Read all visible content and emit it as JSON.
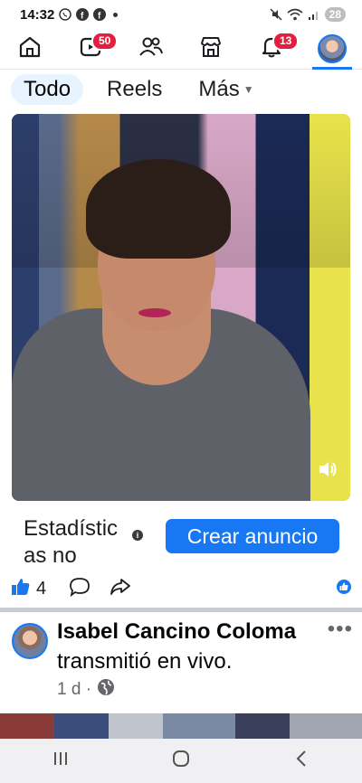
{
  "status_bar": {
    "time": "14:32",
    "battery": "28"
  },
  "top_nav": {
    "items": [
      {
        "name": "home",
        "icon": "home-icon"
      },
      {
        "name": "video",
        "icon": "video-icon",
        "badge": "50"
      },
      {
        "name": "friends",
        "icon": "friends-icon"
      },
      {
        "name": "marketplace",
        "icon": "marketplace-icon"
      },
      {
        "name": "notifications",
        "icon": "bell-icon",
        "badge": "13"
      },
      {
        "name": "profile",
        "icon": "avatar"
      }
    ]
  },
  "filters": {
    "all": "Todo",
    "reels": "Reels",
    "more": "Más"
  },
  "video_post": {
    "stats_text": "Estadísticas no",
    "create_ad": "Crear anuncio",
    "like_count": "4"
  },
  "live_post": {
    "author": "Isabel Cancino Coloma",
    "action": "transmitió en vivo.",
    "time": "1 d ·"
  },
  "colors": {
    "accent": "#1877f2",
    "badge": "#e41e3f"
  }
}
